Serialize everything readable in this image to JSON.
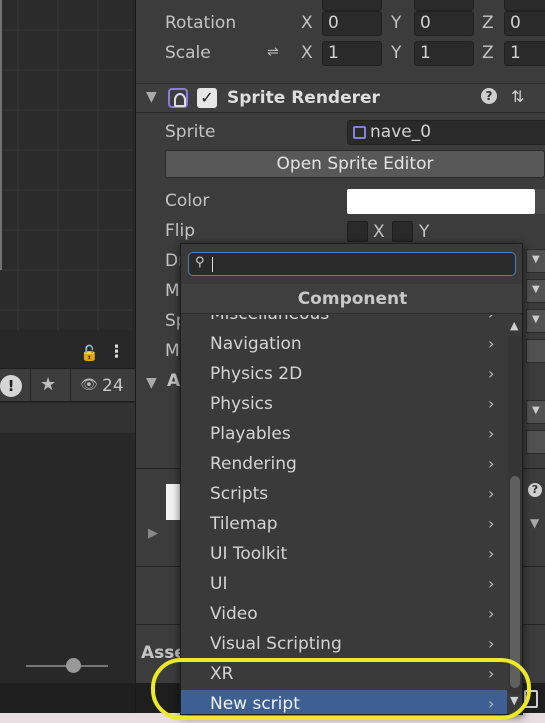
{
  "left_panel": {
    "lock_icon": "lock-icon",
    "menu_icon": "kebab-icon",
    "warning_glyph": "!",
    "visibility_count": "24"
  },
  "inspector": {
    "top_labels": {
      "rotation": "Rotation",
      "scale": "Scale"
    },
    "axes": {
      "x": "X",
      "y": "Y",
      "z": "Z"
    },
    "rotation": {
      "x": "0",
      "y": "0",
      "z": "0"
    },
    "scale": {
      "x": "1",
      "y": "1",
      "z": "1"
    },
    "component": {
      "title": "Sprite Renderer",
      "help": "?"
    },
    "sprite_label": "Sprite",
    "sprite_value": "nave_0",
    "open_sprite_editor": "Open Sprite Editor",
    "color_label": "Color",
    "color_value": "#ffffff",
    "flip_label": "Flip",
    "flip_x": "X",
    "flip_y": "Y",
    "truncated_labels": [
      "Dr",
      "M",
      "Sp",
      "M",
      "A"
    ],
    "assets_label": "Asse"
  },
  "popup": {
    "search_placeholder": "",
    "header": "Component",
    "items": [
      {
        "label": "Miscellaneous",
        "selected": false
      },
      {
        "label": "Navigation",
        "selected": false
      },
      {
        "label": "Physics 2D",
        "selected": false
      },
      {
        "label": "Physics",
        "selected": false
      },
      {
        "label": "Playables",
        "selected": false
      },
      {
        "label": "Rendering",
        "selected": false
      },
      {
        "label": "Scripts",
        "selected": false
      },
      {
        "label": "Tilemap",
        "selected": false
      },
      {
        "label": "UI Toolkit",
        "selected": false
      },
      {
        "label": "UI",
        "selected": false
      },
      {
        "label": "Video",
        "selected": false
      },
      {
        "label": "Visual Scripting",
        "selected": false
      },
      {
        "label": "XR",
        "selected": false
      },
      {
        "label": "New script",
        "selected": true
      }
    ]
  },
  "colors": {
    "highlight": "#ece927",
    "selection": "#3d5f91",
    "panel": "#3c3c3c"
  }
}
